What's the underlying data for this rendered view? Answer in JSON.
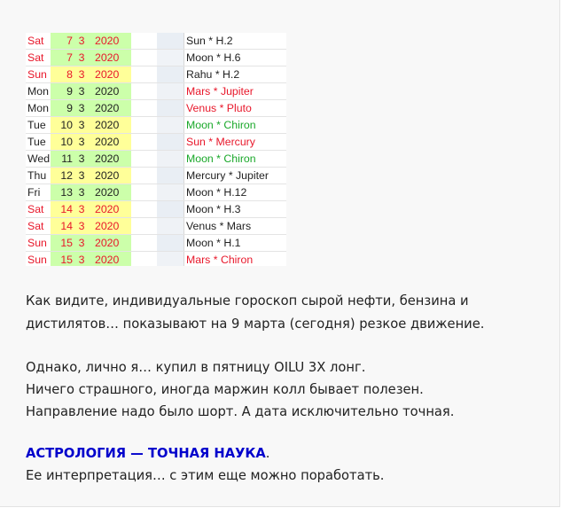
{
  "table": {
    "rows": [
      {
        "day": "Sat",
        "d": "7",
        "m": "3",
        "y": "2020",
        "event": "Sun * H.2",
        "dateColor": "#e8172a",
        "eventColor": "#222222",
        "bg": "#ccffaa",
        "blur": "#e9eef4"
      },
      {
        "day": "Sat",
        "d": "7",
        "m": "3",
        "y": "2020",
        "event": "Moon * H.6",
        "dateColor": "#e8172a",
        "eventColor": "#222222",
        "bg": "#ccffaa",
        "blur": "#f0f3f7"
      },
      {
        "day": "Sun",
        "d": "8",
        "m": "3",
        "y": "2020",
        "event": "Rahu * H.2",
        "dateColor": "#e8172a",
        "eventColor": "#222222",
        "bg": "#ffff99",
        "blur": "#e9eef4"
      },
      {
        "day": "Mon",
        "d": "9",
        "m": "3",
        "y": "2020",
        "event": "Mars * Jupiter",
        "dateColor": "#222222",
        "eventColor": "#e8172a",
        "bg": "#ccffaa",
        "blur": "#eff2f6"
      },
      {
        "day": "Mon",
        "d": "9",
        "m": "3",
        "y": "2020",
        "event": "Venus * Pluto",
        "dateColor": "#222222",
        "eventColor": "#e8172a",
        "bg": "#ccffaa",
        "blur": "#e9eef4"
      },
      {
        "day": "Tue",
        "d": "10",
        "m": "3",
        "y": "2020",
        "event": "Moon * Chiron",
        "dateColor": "#222222",
        "eventColor": "#1aa82a",
        "bg": "#ffff99",
        "blur": "#eff2f6"
      },
      {
        "day": "Tue",
        "d": "10",
        "m": "3",
        "y": "2020",
        "event": "Sun * Mercury",
        "dateColor": "#222222",
        "eventColor": "#e8172a",
        "bg": "#ffff99",
        "blur": "#e9eef4"
      },
      {
        "day": "Wed",
        "d": "11",
        "m": "3",
        "y": "2020",
        "event": "Moon * Chiron",
        "dateColor": "#222222",
        "eventColor": "#1aa82a",
        "bg": "#ccffaa",
        "blur": "#eff2f6"
      },
      {
        "day": "Thu",
        "d": "12",
        "m": "3",
        "y": "2020",
        "event": "Mercury * Jupiter",
        "dateColor": "#222222",
        "eventColor": "#222222",
        "bg": "#ffff99",
        "blur": "#e9eef4"
      },
      {
        "day": "Fri",
        "d": "13",
        "m": "3",
        "y": "2020",
        "event": "Moon * H.12",
        "dateColor": "#222222",
        "eventColor": "#222222",
        "bg": "#ccffaa",
        "blur": "#eff2f6"
      },
      {
        "day": "Sat",
        "d": "14",
        "m": "3",
        "y": "2020",
        "event": "Moon * H.3",
        "dateColor": "#e8172a",
        "eventColor": "#222222",
        "bg": "#ffff99",
        "blur": "#e9eef4"
      },
      {
        "day": "Sat",
        "d": "14",
        "m": "3",
        "y": "2020",
        "event": "Venus * Mars",
        "dateColor": "#e8172a",
        "eventColor": "#222222",
        "bg": "#ffff99",
        "blur": "#eff2f6"
      },
      {
        "day": "Sun",
        "d": "15",
        "m": "3",
        "y": "2020",
        "event": "Moon * H.1",
        "dateColor": "#e8172a",
        "eventColor": "#222222",
        "bg": "#ccffaa",
        "blur": "#e9eef4"
      },
      {
        "day": "Sun",
        "d": "15",
        "m": "3",
        "y": "2020",
        "event": "Mars * Chiron",
        "dateColor": "#e8172a",
        "eventColor": "#e8172a",
        "bg": "#ccffaa",
        "blur": "#eff2f6"
      }
    ]
  },
  "paragraphs": {
    "p1_line1": "Как видите, индивидуальные гороскоп сырой нефти, бензина и",
    "p1_line2": "дистилятов… показывают на 9 марта (сегодня) резкое движение.",
    "p2_line1": "Однако, лично я… купил в пятницу OILU 3X лонг.",
    "p2_line2": "Ничего страшного, иногда маржин колл бывает полезен.",
    "p2_line3": "Направление надо было шорт. А дата исключительно точная.",
    "p3_highlight": "АСТРОЛОГИЯ — ТОЧНАЯ НАУКА",
    "p3_period": ".",
    "p3_line2": "Ее интерпретация… с этим еще можно поработать."
  }
}
